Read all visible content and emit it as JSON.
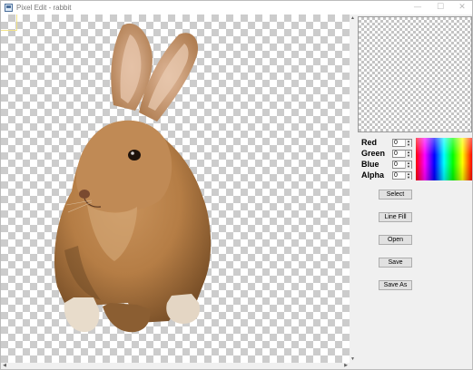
{
  "window": {
    "title": "Pixel Edit - rabbit",
    "minimize_glyph": "—",
    "maximize_glyph": "☐",
    "close_glyph": "✕"
  },
  "canvas": {
    "image_subject": "rabbit",
    "background": "transparency-checkerboard"
  },
  "scrollbars": {
    "up_arrow": "▲",
    "down_arrow": "▼",
    "left_arrow": "◀",
    "right_arrow": "▶"
  },
  "color_panel": {
    "channels": [
      {
        "label": "Red",
        "value": "0"
      },
      {
        "label": "Green",
        "value": "0"
      },
      {
        "label": "Blue",
        "value": "0"
      },
      {
        "label": "Alpha",
        "value": "0"
      }
    ],
    "spinner_up": "▲",
    "spinner_down": "▼"
  },
  "tools": {
    "select_label": "Select",
    "line_fill_label": "Line Fill",
    "open_label": "Open",
    "save_label": "Save",
    "save_as_label": "Save As"
  },
  "colors": {
    "window_bg": "#f0f0f0",
    "button_bg": "#e1e1e1",
    "checker_dark": "#cccccc",
    "checker_light": "#ffffff"
  }
}
